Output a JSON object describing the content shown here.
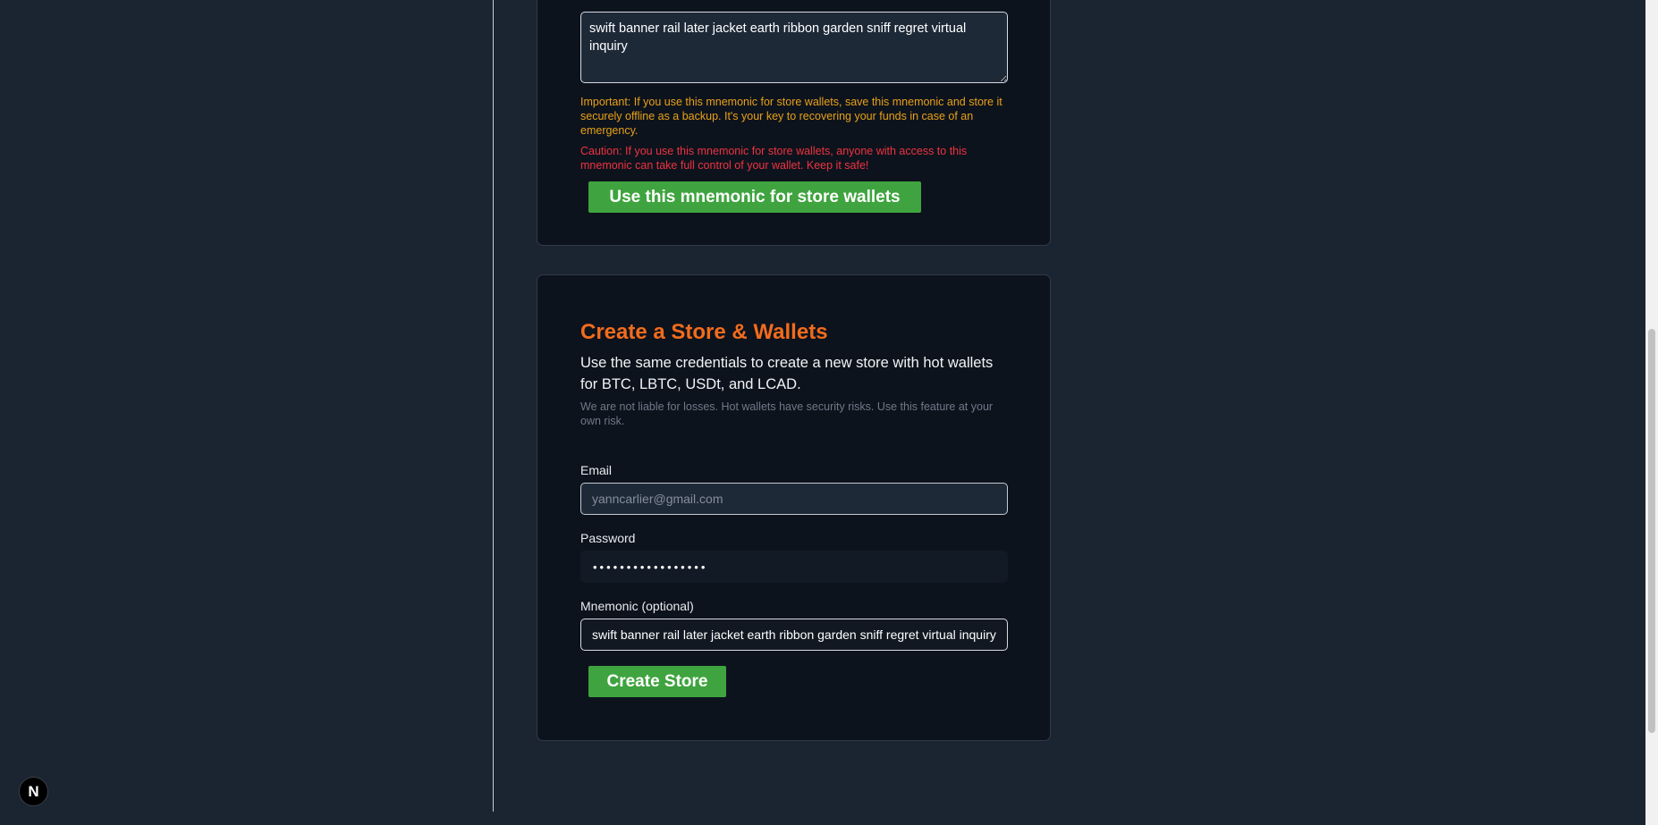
{
  "mnemonic_card": {
    "mnemonic_text": "swift banner rail later jacket earth ribbon garden sniff regret virtual inquiry",
    "important_note": "Important: If you use this mnemonic for store wallets, save this mnemonic and store it securely offline as a backup. It's your key to recovering your funds in case of an emergency.",
    "caution_note": "Caution: If you use this mnemonic for store wallets, anyone with access to this mnemonic can take full control of your wallet. Keep it safe!",
    "use_button_label": "Use this mnemonic for store wallets"
  },
  "store_card": {
    "title": "Create a Store & Wallets",
    "description": "Use the same credentials to create a new store with hot wallets for BTC, LBTC, USDt, and LCAD.",
    "disclaimer": "We are not liable for losses. Hot wallets have security risks. Use this feature at your own risk.",
    "email_label": "Email",
    "email_placeholder": "yanncarlier@gmail.com",
    "password_label": "Password",
    "password_value": "•••••••••••••••••",
    "mnemonic_label": "Mnemonic (optional)",
    "mnemonic_value": "swift banner rail later jacket earth ribbon garden sniff regret virtual inquiry",
    "create_button_label": "Create Store"
  },
  "dev_badge": {
    "letter": "N"
  },
  "colors": {
    "background": "#1b2431",
    "card": "#0d131d",
    "accent_orange": "#f26c1c",
    "warning_orange": "#e8a117",
    "caution_red": "#ee3340",
    "button_green": "#3fa43f"
  }
}
